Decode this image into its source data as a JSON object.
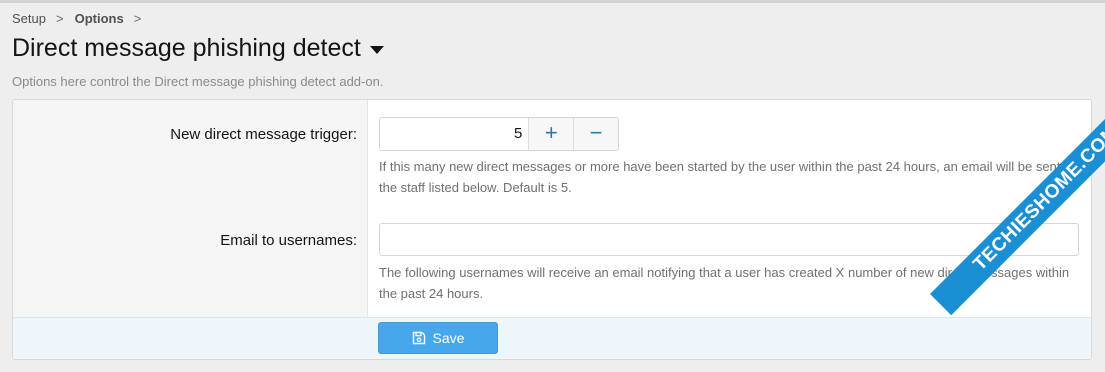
{
  "breadcrumb": {
    "items": [
      "Setup",
      "Options"
    ],
    "separator": ">"
  },
  "page": {
    "title": "Direct message phishing detect",
    "description": "Options here control the Direct message phishing detect add-on."
  },
  "options": {
    "trigger": {
      "label": "New direct message trigger:",
      "value": "5",
      "increment": "+",
      "decrement": "−",
      "explain": "If this many new direct messages or more have been started by the user within the past 24 hours, an email will be sent to the staff listed below. Default is 5."
    },
    "email": {
      "label": "Email to usernames:",
      "value": "",
      "explain": "The following usernames will receive an email notifying that a user has created X number of new direct messages within the past 24 hours."
    }
  },
  "footer": {
    "save_label": "Save"
  },
  "watermark": {
    "text": "TECHIESHOME.COM"
  },
  "colors": {
    "accent": "#47a7eb",
    "link": "#2577b1",
    "watermark": "#1a8fd4"
  },
  "icons": {
    "save": "floppy-disk-icon",
    "title_menu": "caret-down-icon"
  }
}
